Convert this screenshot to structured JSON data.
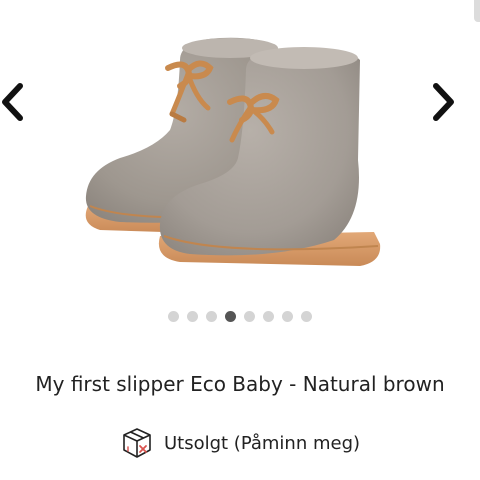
{
  "product": {
    "title": "My first slipper Eco Baby - Natural brown",
    "stock_status": "Utsolgt (Påminn meg)",
    "stock_icon": "out-of-stock-box-icon"
  },
  "gallery": {
    "prev_icon": "chevron-left-icon",
    "next_icon": "chevron-right-icon",
    "dot_count": 8,
    "active_index": 3
  },
  "colors": {
    "felt": "#a49d96",
    "sole": "#d99b67",
    "lace": "#c98a4e",
    "active_dot": "#555555",
    "inactive_dot": "#d4d4d4",
    "icon_accent": "#d9534f"
  }
}
